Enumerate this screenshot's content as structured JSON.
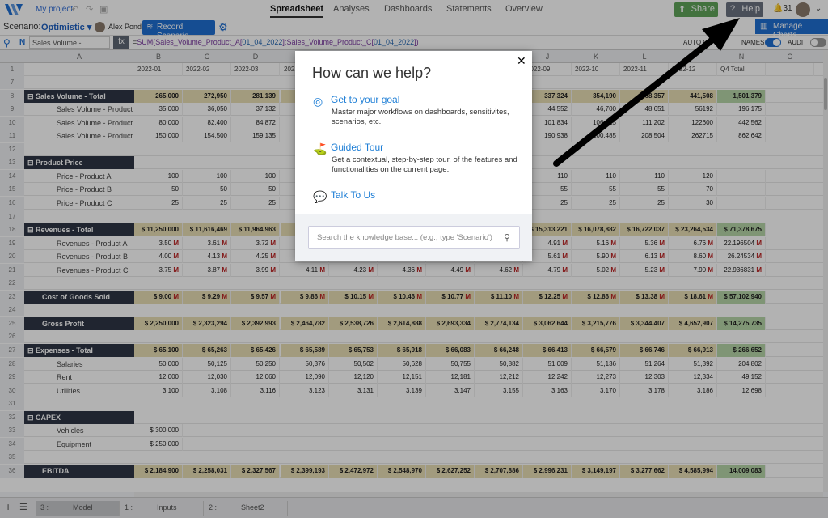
{
  "topbar": {
    "project": "My project",
    "nav": [
      "Spreadsheet",
      "Analyses",
      "Dashboards",
      "Statements",
      "Overview"
    ],
    "active_nav": "Spreadsheet",
    "share": "Share",
    "help": "Help",
    "notifications": "31"
  },
  "scenario": {
    "label": "Scenario:",
    "value": "Optimistic",
    "user": "Alex Pond",
    "record": "Record Scenario",
    "manage_charts": "Manage Charts"
  },
  "formula_bar": {
    "name_box": "Sales Volume -",
    "fx": "fx",
    "formula_parts": [
      [
        "=",
        ""
      ],
      [
        "SUM(",
        "p"
      ],
      [
        "Sales_Volume_Product_A",
        "v"
      ],
      [
        "[",
        "p"
      ],
      [
        "01_04_2022",
        "g"
      ],
      [
        "]:",
        "p"
      ],
      [
        "Sales_Volume_Product_C",
        "v"
      ],
      [
        "[",
        "p"
      ],
      [
        "01_04_2022",
        "g"
      ],
      [
        "])",
        "p"
      ]
    ],
    "auto_calc": "AUTO CA",
    "names": "NAMES",
    "audit": "AUDIT"
  },
  "colors": {
    "formula_p": "#7a3aa0",
    "formula_v": "#7a3aa0",
    "formula_g": "#2a6ab3"
  },
  "grid": {
    "col_letters": [
      "A",
      "B",
      "C",
      "D",
      "E",
      "F",
      "G",
      "H",
      "I",
      "J",
      "K",
      "L",
      "M",
      "N",
      "O"
    ],
    "row1": [
      "",
      "2022-01",
      "2022-02",
      "2022-03",
      "2022-04",
      "",
      "",
      "",
      "",
      "2022-09",
      "2022-10",
      "2022-11",
      "2022-12",
      "Q4 Total",
      ""
    ],
    "rows": [
      {
        "n": "7",
        "label": "",
        "style": "blank",
        "cells": []
      },
      {
        "n": "8",
        "label": "⊟ Sales Volume - Total",
        "style": "dark",
        "fill": "tan",
        "cells": [
          "265,000",
          "272,950",
          "281,139",
          "",
          "",
          "",
          "",
          "",
          "337,324",
          "354,190",
          "368,357",
          "441,508",
          "1,501,379"
        ]
      },
      {
        "n": "9",
        "label": "Sales Volume - Product A",
        "style": "sub",
        "cells": [
          "35,000",
          "36,050",
          "37,132",
          "",
          "",
          "",
          "",
          "",
          "44,552",
          "46,700",
          "48,651",
          "56192",
          "196,175"
        ]
      },
      {
        "n": "10",
        "label": "Sales Volume - Product B",
        "style": "sub",
        "cells": [
          "80,000",
          "82,400",
          "84,872",
          "",
          "",
          "",
          "",
          "",
          "101,834",
          "106,925",
          "111,202",
          "122600",
          "442,562"
        ]
      },
      {
        "n": "11",
        "label": "Sales Volume - Product C",
        "style": "sub",
        "cells": [
          "150,000",
          "154,500",
          "159,135",
          "",
          "",
          "",
          "",
          "",
          "190,938",
          "200,485",
          "208,504",
          "262715",
          "862,642"
        ]
      },
      {
        "n": "12",
        "label": "",
        "style": "blank",
        "cells": []
      },
      {
        "n": "13",
        "label": "⊟ Product Price",
        "style": "dark",
        "cells": []
      },
      {
        "n": "14",
        "label": "Price - Product A",
        "style": "sub",
        "cells": [
          "100",
          "100",
          "100",
          "",
          "",
          "",
          "",
          "",
          "110",
          "110",
          "110",
          "120",
          ""
        ]
      },
      {
        "n": "15",
        "label": "Price - Product B",
        "style": "sub",
        "cells": [
          "50",
          "50",
          "50",
          "",
          "",
          "",
          "",
          "",
          "55",
          "55",
          "55",
          "70",
          ""
        ]
      },
      {
        "n": "16",
        "label": "Price - Product C",
        "style": "sub",
        "cells": [
          "25",
          "25",
          "25",
          "",
          "",
          "",
          "",
          "",
          "25",
          "25",
          "25",
          "30",
          ""
        ]
      },
      {
        "n": "17",
        "label": "",
        "style": "blank",
        "cells": []
      },
      {
        "n": "18",
        "label": "⊟ Revenues - Total",
        "style": "dark",
        "fill": "tan",
        "cells": [
          "$ 11,250,000",
          "$ 11,616,469",
          "$ 11,964,963",
          "",
          "",
          "",
          "",
          "",
          "$ 15,313,221",
          "$ 16,078,882",
          "$ 16,722,037",
          "$ 23,264,534",
          "$ 71,378,675"
        ]
      },
      {
        "n": "19",
        "label": "Revenues - Product A",
        "style": "sub",
        "cells": [
          "3.50 M",
          "3.61 M",
          "3.72 M",
          "",
          "",
          "",
          "",
          "",
          "4.91 M",
          "5.16 M",
          "5.36 M",
          "6.76 M",
          "22.196504 M"
        ]
      },
      {
        "n": "20",
        "label": "Revenues - Product B",
        "style": "sub",
        "cells": [
          "4.00 M",
          "4.13 M",
          "4.25 M",
          "4.38 M",
          "4.51 M",
          "4.65 M",
          "4.79 M",
          "4.93 M",
          "5.61 M",
          "5.90 M",
          "6.13 M",
          "8.60 M",
          "26.24534 M"
        ]
      },
      {
        "n": "21",
        "label": "Revenues - Product C",
        "style": "sub",
        "cells": [
          "3.75 M",
          "3.87 M",
          "3.99 M",
          "4.11 M",
          "4.23 M",
          "4.36 M",
          "4.49 M",
          "4.62 M",
          "4.79 M",
          "5.02 M",
          "5.23 M",
          "7.90 M",
          "22.936831 M"
        ]
      },
      {
        "n": "22",
        "label": "",
        "style": "blank",
        "cells": []
      },
      {
        "n": "23",
        "label": "Cost of Goods Sold",
        "style": "dark2",
        "fill": "tan",
        "cells": [
          "$ 9.00 M",
          "$ 9.29 M",
          "$ 9.57 M",
          "$ 9.86 M",
          "$ 10.15 M",
          "$ 10.46 M",
          "$ 10.77 M",
          "$ 11.10 M",
          "$ 12.25 M",
          "$ 12.86 M",
          "$ 13.38 M",
          "$ 18.61 M",
          "$ 57,102,940"
        ]
      },
      {
        "n": "24",
        "label": "",
        "style": "blank",
        "cells": []
      },
      {
        "n": "25",
        "label": "Gross Profit",
        "style": "dark2",
        "fill": "tan",
        "cells": [
          "$ 2,250,000",
          "$ 2,323,294",
          "$ 2,392,993",
          "$ 2,464,782",
          "$ 2,538,726",
          "$ 2,614,888",
          "$ 2,693,334",
          "$ 2,774,134",
          "$ 3,062,644",
          "$ 3,215,776",
          "$ 3,344,407",
          "$ 4,652,907",
          "$ 14,275,735"
        ]
      },
      {
        "n": "26",
        "label": "",
        "style": "blank",
        "cells": []
      },
      {
        "n": "27",
        "label": "⊟ Expenses - Total",
        "style": "dark",
        "fill": "tan",
        "cells": [
          "$ 65,100",
          "$ 65,263",
          "$ 65,426",
          "$ 65,589",
          "$ 65,753",
          "$ 65,918",
          "$ 66,083",
          "$ 66,248",
          "$ 66,413",
          "$ 66,579",
          "$ 66,746",
          "$ 66,913",
          "$ 266,652"
        ]
      },
      {
        "n": "28",
        "label": "Salaries",
        "style": "sub",
        "cells": [
          "50,000",
          "50,125",
          "50,250",
          "50,376",
          "50,502",
          "50,628",
          "50,755",
          "50,882",
          "51,009",
          "51,136",
          "51,264",
          "51,392",
          "204,802"
        ]
      },
      {
        "n": "29",
        "label": "Rent",
        "style": "sub",
        "cells": [
          "12,000",
          "12,030",
          "12,060",
          "12,090",
          "12,120",
          "12,151",
          "12,181",
          "12,212",
          "12,242",
          "12,273",
          "12,303",
          "12,334",
          "49,152"
        ]
      },
      {
        "n": "30",
        "label": "Utilities",
        "style": "sub",
        "cells": [
          "3,100",
          "3,108",
          "3,116",
          "3,123",
          "3,131",
          "3,139",
          "3,147",
          "3,155",
          "3,163",
          "3,170",
          "3,178",
          "3,186",
          "12,698"
        ]
      },
      {
        "n": "31",
        "label": "",
        "style": "blank",
        "cells": []
      },
      {
        "n": "32",
        "label": "⊟ CAPEX",
        "style": "dark",
        "cells": []
      },
      {
        "n": "33",
        "label": "Vehicles",
        "style": "sub",
        "cells": [
          "$ 300,000"
        ]
      },
      {
        "n": "34",
        "label": "Equipment",
        "style": "sub",
        "cells": [
          "$ 250,000"
        ]
      },
      {
        "n": "35",
        "label": "",
        "style": "blank",
        "cells": []
      },
      {
        "n": "36",
        "label": "EBITDA",
        "style": "dark2",
        "fill": "tan",
        "cells": [
          "$ 2,184,900",
          "$ 2,258,031",
          "$ 2,327,567",
          "$ 2,399,193",
          "$ 2,472,972",
          "$ 2,548,970",
          "$ 2,627,252",
          "$ 2,707,886",
          "$ 2,996,231",
          "$ 3,149,197",
          "$ 3,277,662",
          "$ 4,585,994",
          "14,009,083"
        ]
      }
    ]
  },
  "sheets": [
    {
      "num": "3 :",
      "name": "Model"
    },
    {
      "num": "1 :",
      "name": "Inputs"
    },
    {
      "num": "2 :",
      "name": "Sheet2"
    }
  ],
  "help_modal": {
    "title": "How can we help?",
    "items": [
      {
        "icon": "target-icon",
        "head": "Get to your goal",
        "desc": "Master major workflows on dashboards, sensitivites, scenarios, etc."
      },
      {
        "icon": "tour-icon",
        "head": "Guided Tour",
        "desc": "Get a contextual, step-by-step tour, of the features and functionalities on the current page."
      },
      {
        "icon": "chat-icon",
        "head": "Talk To Us",
        "desc": ""
      }
    ],
    "search_placeholder": "Search the knowledge base... (e.g., type 'Scenario')"
  }
}
